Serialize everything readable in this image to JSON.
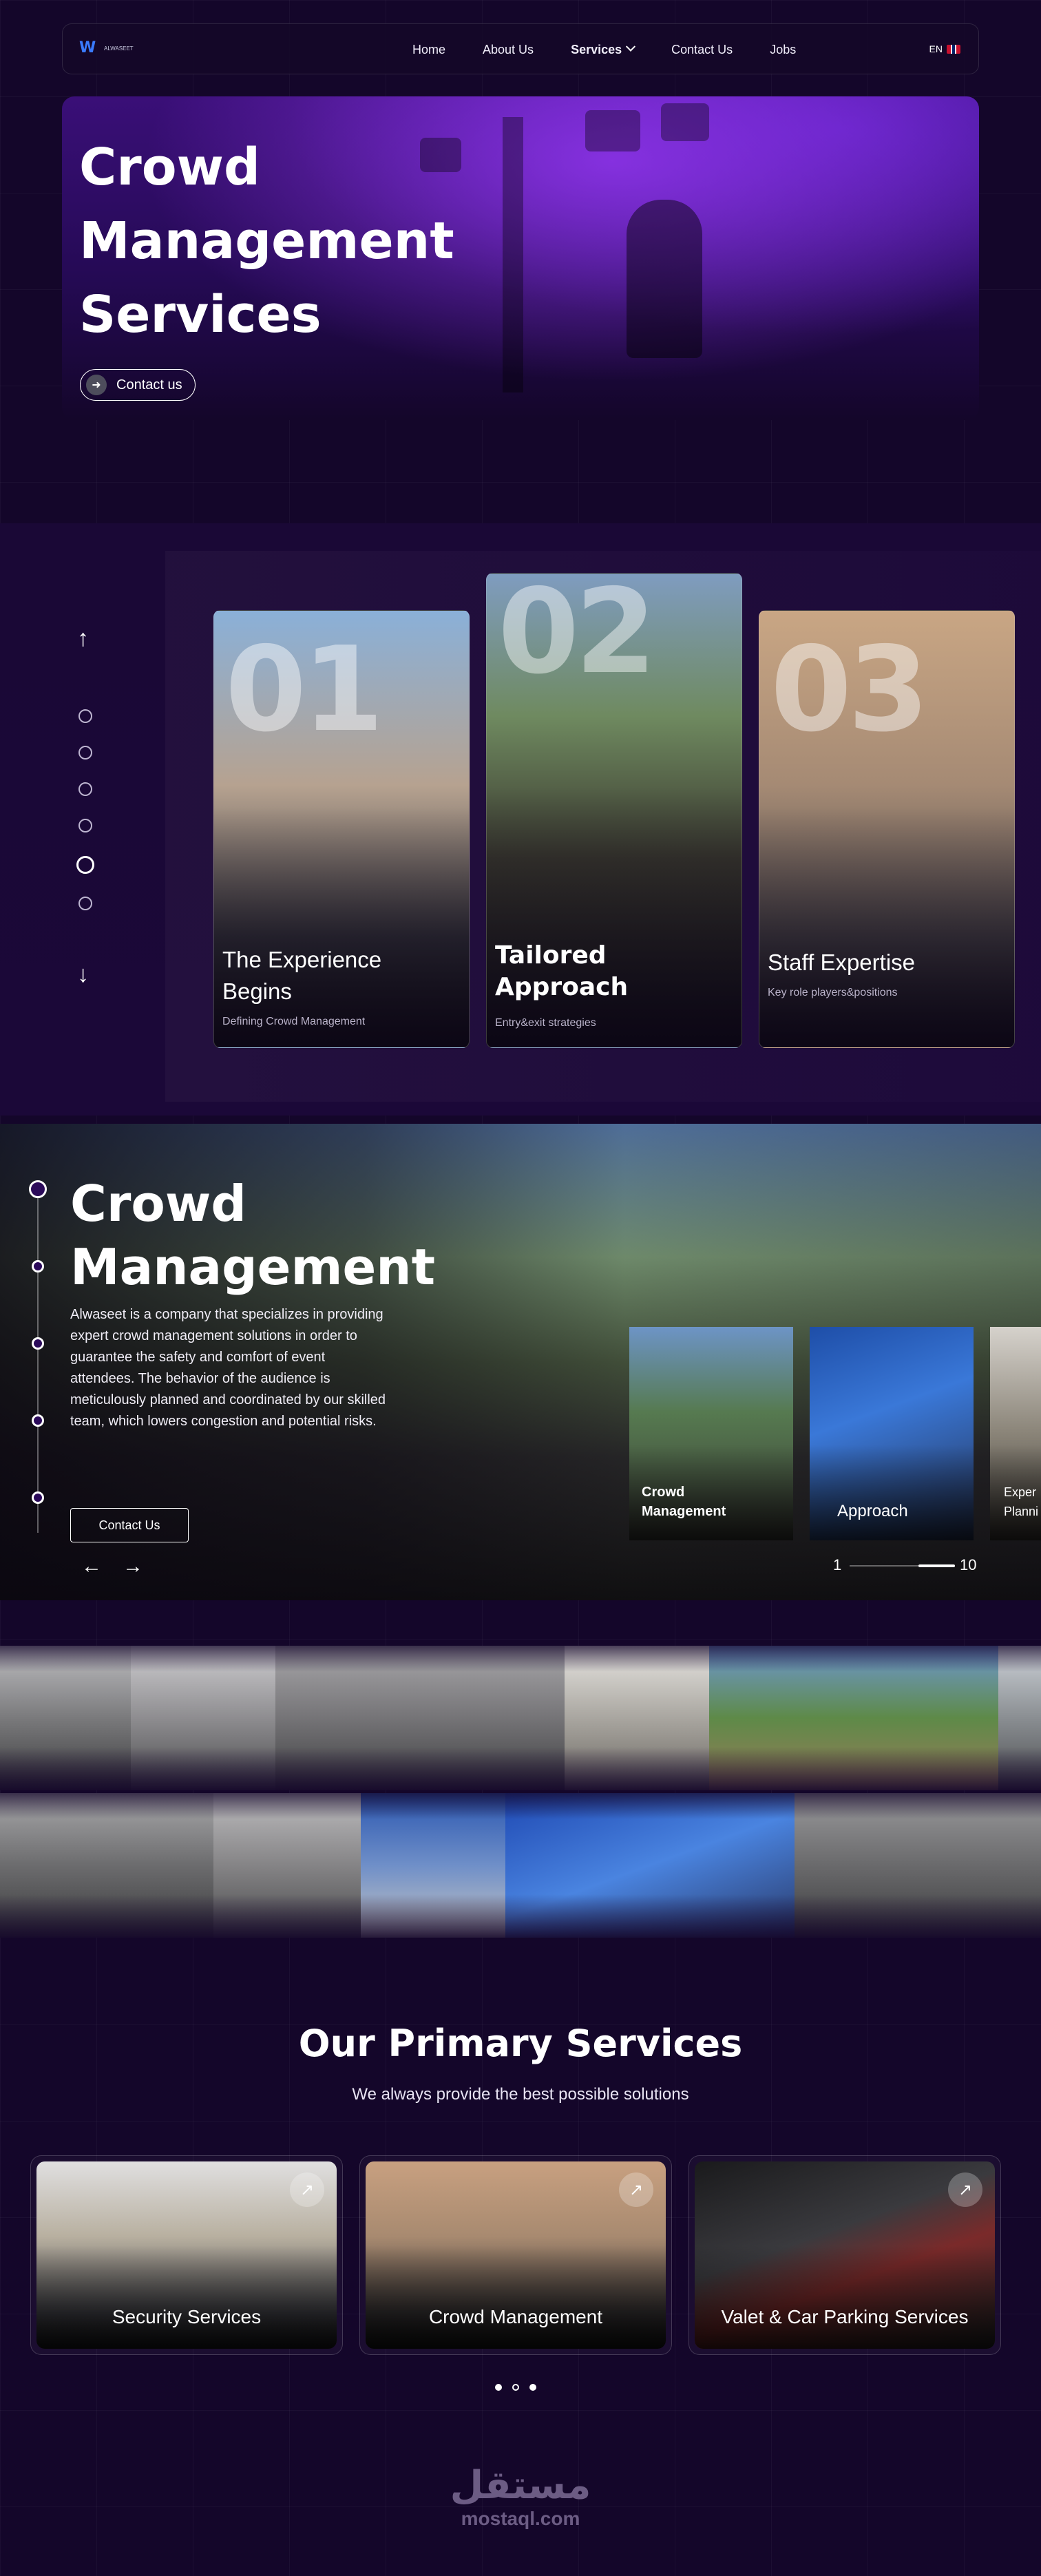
{
  "nav": {
    "logo_text": "ALWASEET",
    "links": [
      {
        "label": "Home"
      },
      {
        "label": "About Us"
      },
      {
        "label": "Services"
      },
      {
        "label": "Contact Us"
      },
      {
        "label": "Jobs"
      }
    ],
    "language": "EN"
  },
  "hero": {
    "title_line1": "Crowd",
    "title_line2": "Management",
    "title_line3": "Services",
    "cta_label": "Contact us",
    "cta_icon": "arrow-right-icon"
  },
  "experience": {
    "cards": [
      {
        "number": "01",
        "title_line1": "The Experience",
        "title_line2": "Begins",
        "subtitle": "Defining Crowd Management",
        "bold": false
      },
      {
        "number": "02",
        "title_line1": "Tailored",
        "title_line2": "Approach",
        "subtitle": "Entry&exit strategies",
        "bold": true
      },
      {
        "number": "03",
        "title_line1": "Staff Expertise",
        "title_line2": "",
        "subtitle": "Key role players&positions",
        "bold": false
      }
    ],
    "active_dot_index": 4,
    "dot_count": 6
  },
  "crowd": {
    "title_line1": "Crowd",
    "title_line2": "Management",
    "description": "Alwaseet is a company that specializes in providing expert crowd management solutions in order to guarantee the safety and comfort of event attendees. The behavior of the audience is meticulously planned and coordinated by our skilled team, which lowers congestion and potential risks.",
    "button_label": "Contact Us",
    "thumbnails": [
      {
        "label_line1": "Crowd",
        "label_line2": "Management"
      },
      {
        "label_line1": "Approach",
        "label_line2": ""
      },
      {
        "label_line1": "Exper",
        "label_line2": "Planni"
      }
    ],
    "counter_current": "1",
    "counter_total": "10",
    "progress": 0.35
  },
  "primary_services": {
    "title": "Our Primary Services",
    "subtitle": "We always provide the best possible solutions",
    "items": [
      {
        "label": "Security Services"
      },
      {
        "label": "Crowd Management"
      },
      {
        "label": "Valet & Car Parking Services"
      }
    ]
  },
  "watermark": {
    "arabic": "مستقل",
    "english": "mostaql.com"
  },
  "colors": {
    "background": "#14062a",
    "accent_purple": "#6a22d6",
    "text": "#ffffff"
  }
}
